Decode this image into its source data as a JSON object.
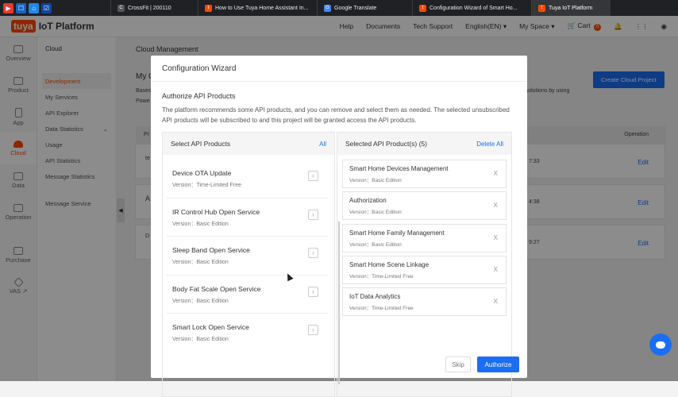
{
  "browser": {
    "tabs": [
      {
        "label": "CrossFit | 200110",
        "fav": "C",
        "color": "#555"
      },
      {
        "label": "How to Use Tuya Home Assistant In...",
        "fav": "t",
        "color": "#ff4800"
      },
      {
        "label": "Google Translate",
        "fav": "G",
        "color": "#4285f4"
      },
      {
        "label": "Configuration Wizard of Smart Ho...",
        "fav": "t",
        "color": "#ff4800"
      },
      {
        "label": "Tuya IoT Platform",
        "fav": "t",
        "color": "#ff4800"
      }
    ]
  },
  "header": {
    "logo": "tuya",
    "product": "IoT Platform",
    "nav": [
      "Help",
      "Documents",
      "Tech Support",
      "English(EN) ▾",
      "My Space ▾"
    ],
    "cart_label": "Cart",
    "cart_count": "0"
  },
  "iconbar": [
    "Overview",
    "Product",
    "App",
    "Cloud",
    "Data",
    "Operation",
    "Purchase",
    "VAS ↗"
  ],
  "subnav": {
    "title": "Cloud",
    "items": [
      "Development",
      "My Services",
      "API Explorer",
      "Data Statistics",
      "Usage",
      "API Statistics",
      "Message Statistics",
      "Message Service"
    ]
  },
  "main": {
    "breadcrumb": "Cloud Management",
    "heading_partial": "My C",
    "desc_partial_1": "Based",
    "desc_partial_2": "Powe",
    "desc_right": "try solutions by using",
    "create_button": "Create Cloud Project",
    "operation_col": "Operation",
    "col_partial": "Pr",
    "rows": [
      {
        "left": "te",
        "time": "7:33",
        "action": "Edit"
      },
      {
        "left": "A",
        "time": "4:38",
        "action": "Edit"
      },
      {
        "left": "D",
        "time": "9:27",
        "action": "Edit"
      }
    ]
  },
  "modal": {
    "title": "Configuration Wizard",
    "section_title": "Authorize API Products",
    "description": "The platform recommends some API products, and you can remove and select them as needed. The selected unsubscribed API products will be subscribed to and this project will be granted access the API products.",
    "left_header": "Select API Products",
    "left_action": "All",
    "right_header": "Selected API Product(s) (5)",
    "right_action": "Delete All",
    "available": [
      {
        "name": "Device OTA Update",
        "version": "Version：Time-Limited Free"
      },
      {
        "name": "IR Control Hub Open Service",
        "version": "Version：Basic Edition"
      },
      {
        "name": "Sleep Band Open Service",
        "version": "Version：Basic Edition"
      },
      {
        "name": "Body Fat Scale Open Service",
        "version": "Version：Basic Edition"
      },
      {
        "name": "Smart Lock Open Service",
        "version": "Version：Basic Edition"
      }
    ],
    "selected": [
      {
        "name": "Smart Home Devices Management",
        "version": "Version：Basic Edition"
      },
      {
        "name": "Authorization",
        "version": "Version：Basic Edition"
      },
      {
        "name": "Smart Home Family Management",
        "version": "Version：Basic Edition"
      },
      {
        "name": "Smart Home Scene Linkage",
        "version": "Version：Time-Limited Free"
      },
      {
        "name": "IoT Data Analytics",
        "version": "Version：Time-Limited Free"
      }
    ],
    "skip_button": "Skip",
    "authorize_button": "Authorize"
  }
}
